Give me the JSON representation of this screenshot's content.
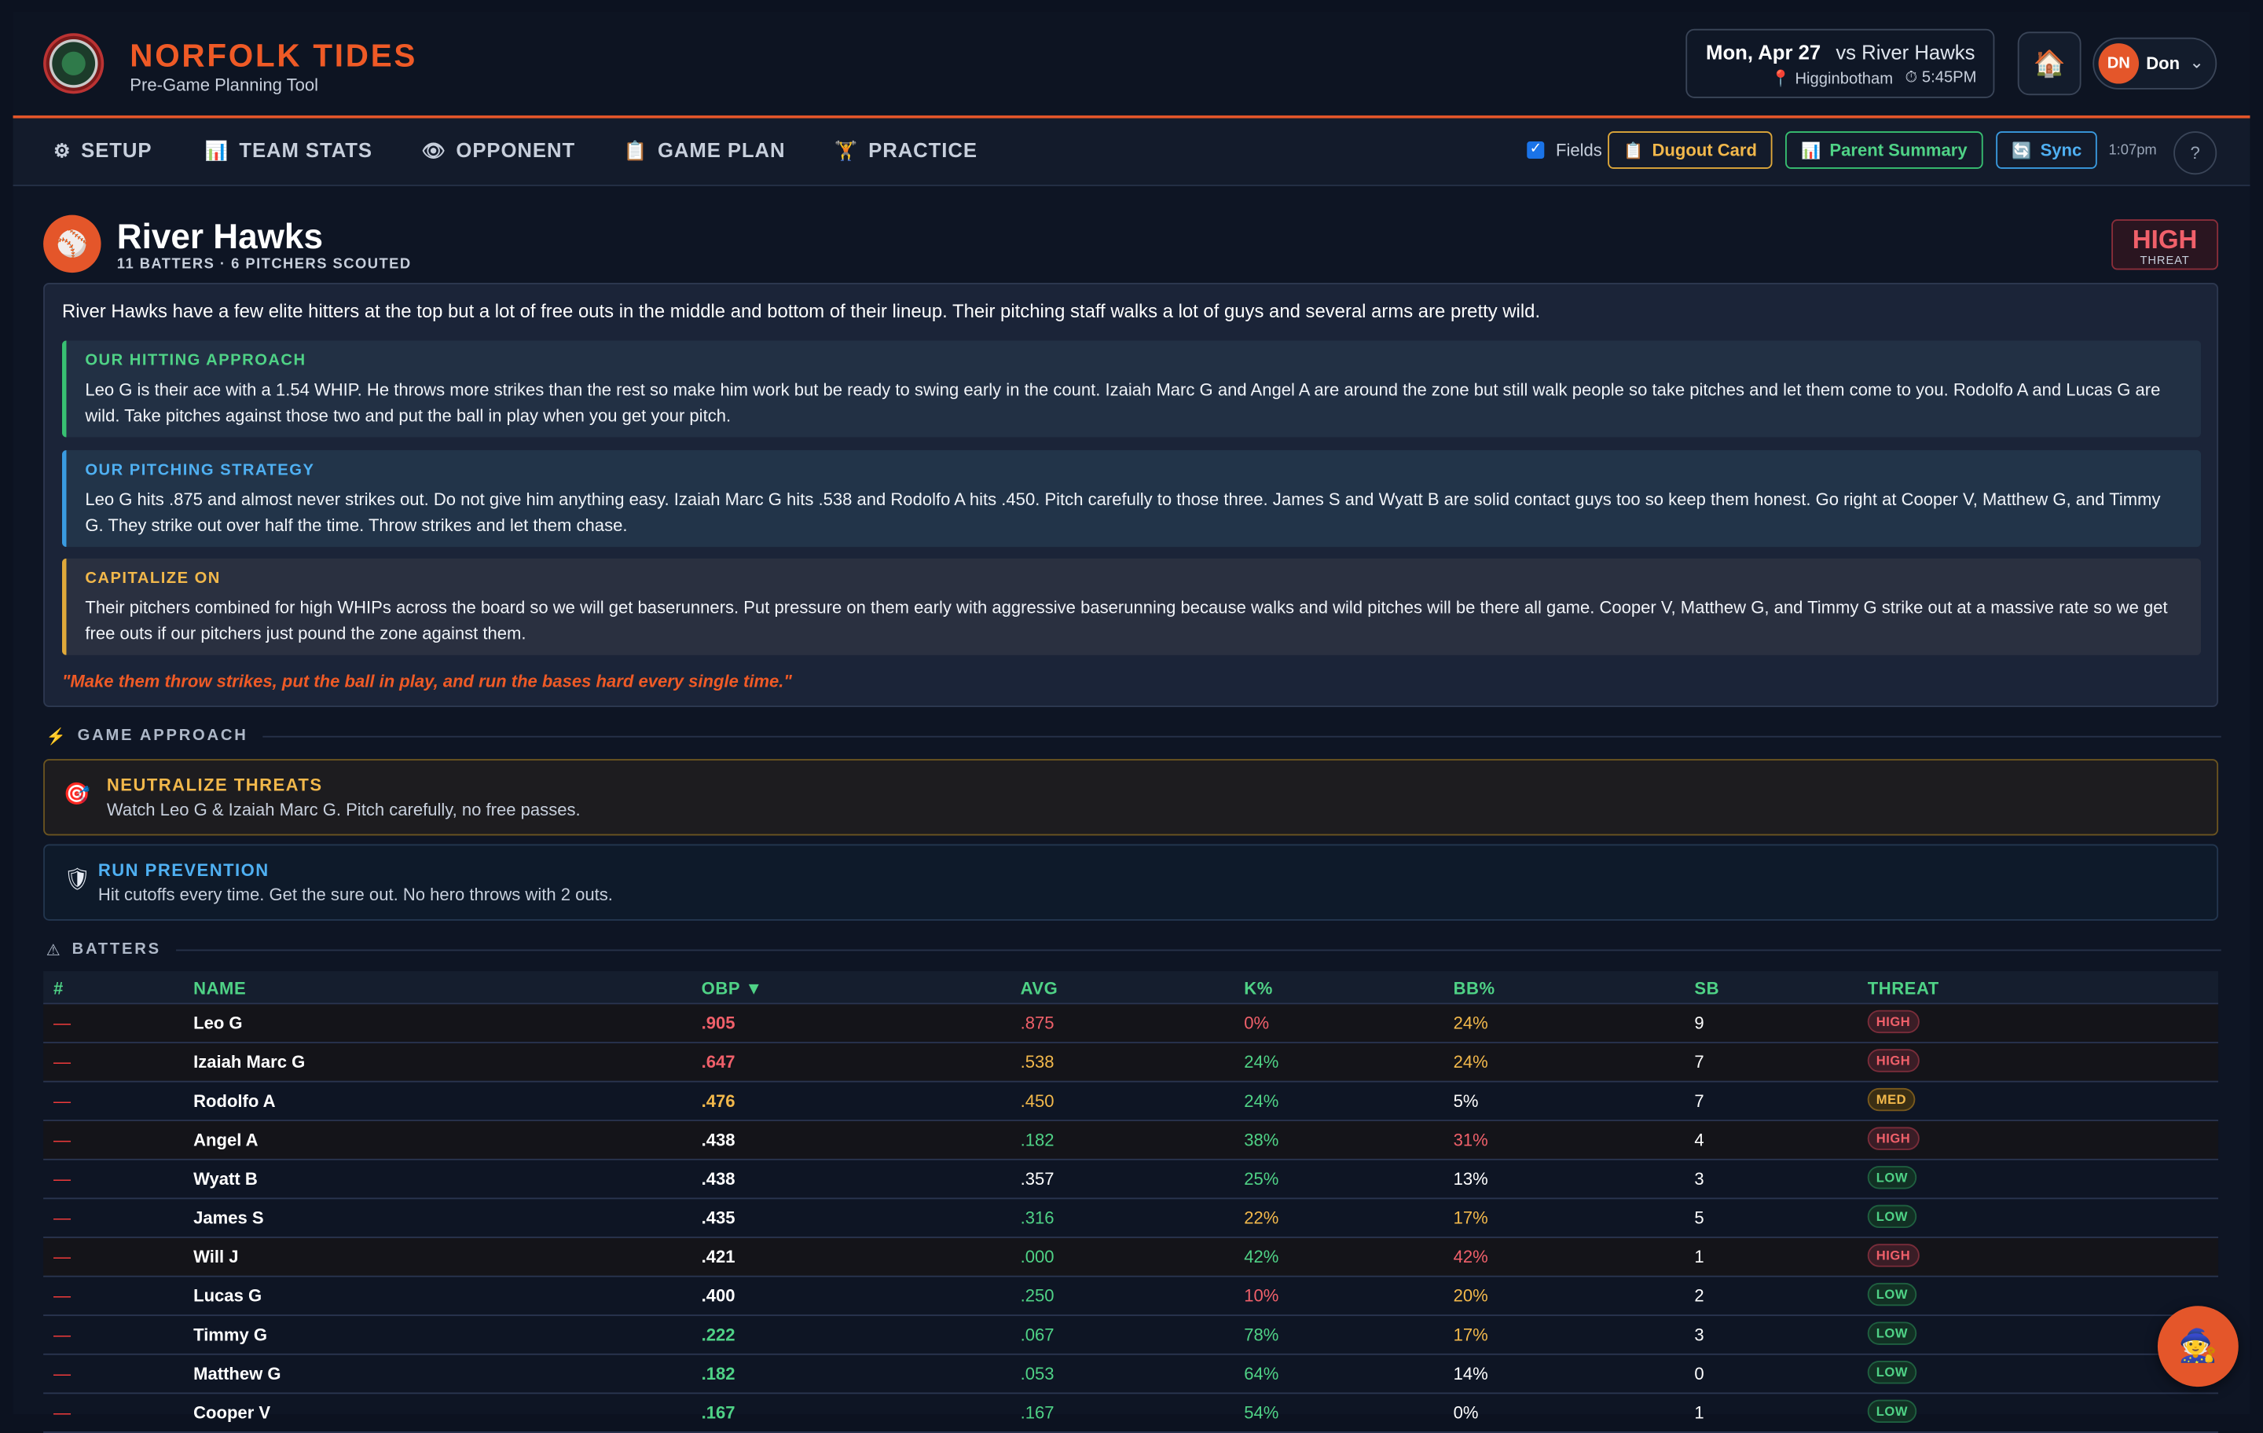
{
  "header": {
    "brand_title": "NORFOLK TIDES",
    "brand_subtitle": "Pre-Game Planning Tool",
    "game_date": "Mon, Apr 27",
    "game_opponent": "vs River Hawks",
    "game_location": "📍 Higginbotham",
    "game_time": "⏱ 5:45PM",
    "home_icon": "🏠",
    "user_initials": "DN",
    "user_name": "Don",
    "user_chevron": "⌄"
  },
  "nav": {
    "tabs": [
      {
        "label": "SETUP",
        "icon": "⚙"
      },
      {
        "label": "TEAM STATS",
        "icon": "📊"
      },
      {
        "label": "OPPONENT",
        "icon": "👁"
      },
      {
        "label": "GAME PLAN",
        "icon": "📋"
      },
      {
        "label": "PRACTICE",
        "icon": "🏋"
      }
    ],
    "fields_label": "Fields",
    "dugout_label": "Dugout Card",
    "dugout_icon": "📋",
    "parent_label": "Parent Summary",
    "parent_icon": "📊",
    "sync_label": "Sync",
    "sync_icon": "🔄",
    "clock": "1:07pm",
    "help": "?"
  },
  "opponent": {
    "icon": "⚾",
    "name": "River Hawks",
    "meta": "11 BATTERS · 6 PITCHERS SCOUTED",
    "threat_level": "HIGH",
    "threat_label": "THREAT"
  },
  "summary": {
    "text": "River Hawks have a few elite hitters at the top but a lot of free outs in the middle and bottom of their lineup. Their pitching staff walks a lot of guys and several arms are pretty wild.",
    "hitting_title": "OUR HITTING APPROACH",
    "hitting_body": "Leo G is their ace with a 1.54 WHIP. He throws more strikes than the rest so make him work but be ready to swing early in the count. Izaiah Marc G and Angel A are around the zone but still walk people so take pitches and let them come to you. Rodolfo A and Lucas G are wild. Take pitches against those two and put the ball in play when you get your pitch.",
    "pitching_title": "OUR PITCHING STRATEGY",
    "pitching_body": "Leo G hits .875 and almost never strikes out. Do not give him anything easy. Izaiah Marc G hits .538 and Rodolfo A hits .450. Pitch carefully to those three. James S and Wyatt B are solid contact guys too so keep them honest. Go right at Cooper V, Matthew G, and Timmy G. They strike out over half the time. Throw strikes and let them chase.",
    "capitalize_title": "CAPITALIZE ON",
    "capitalize_body": "Their pitchers combined for high WHIPs across the board so we will get baserunners. Put pressure on them early with aggressive baserunning because walks and wild pitches will be there all game. Cooper V, Matthew G, and Timmy G strike out at a massive rate so we get free outs if our pitchers just pound the zone against them.",
    "slogan": "\"Make them throw strikes, put the ball in play, and run the bases hard every single time.\""
  },
  "approach": {
    "section_icon": "⚡",
    "section_label": "GAME APPROACH",
    "neutralize_icon": "🎯",
    "neutralize_title": "NEUTRALIZE THREATS",
    "neutralize_body": "Watch Leo G & Izaiah Marc G. Pitch carefully, no free passes.",
    "run_icon": "🛡",
    "run_title": "RUN PREVENTION",
    "run_body": "Hit cutoffs every time. Get the sure out. No hero throws with 2 outs."
  },
  "batters": {
    "section_icon": "⚠",
    "section_label": "BATTERS",
    "headers": {
      "num": "#",
      "name": "NAME",
      "obp": "OBP ▼",
      "avg": "AVG",
      "k": "K%",
      "bb": "BB%",
      "sb": "SB",
      "threat": "THREAT"
    },
    "colors": {
      "red": "#f0606a",
      "orange": "#f2b84b",
      "green": "#4fd286",
      "white": "#ffffff"
    },
    "rows": [
      {
        "num": "—",
        "name": "Leo G",
        "obp": ".905",
        "avg": ".875",
        "k": "0%",
        "bb": "24%",
        "sb": "9",
        "threat": "HIGH",
        "obp_c": "red",
        "avg_c": "red",
        "k_c": "red",
        "bb_c": "orange"
      },
      {
        "num": "—",
        "name": "Izaiah Marc G",
        "obp": ".647",
        "avg": ".538",
        "k": "24%",
        "bb": "24%",
        "sb": "7",
        "threat": "HIGH",
        "obp_c": "red",
        "avg_c": "orange",
        "k_c": "green",
        "bb_c": "orange"
      },
      {
        "num": "—",
        "name": "Rodolfo A",
        "obp": ".476",
        "avg": ".450",
        "k": "24%",
        "bb": "5%",
        "sb": "7",
        "threat": "MED",
        "obp_c": "orange",
        "avg_c": "orange",
        "k_c": "green",
        "bb_c": "white"
      },
      {
        "num": "—",
        "name": "Angel A",
        "obp": ".438",
        "avg": ".182",
        "k": "38%",
        "bb": "31%",
        "sb": "4",
        "threat": "HIGH",
        "obp_c": "white",
        "avg_c": "green",
        "k_c": "green",
        "bb_c": "red"
      },
      {
        "num": "—",
        "name": "Wyatt B",
        "obp": ".438",
        "avg": ".357",
        "k": "25%",
        "bb": "13%",
        "sb": "3",
        "threat": "LOW",
        "obp_c": "white",
        "avg_c": "white",
        "k_c": "green",
        "bb_c": "white"
      },
      {
        "num": "—",
        "name": "James S",
        "obp": ".435",
        "avg": ".316",
        "k": "22%",
        "bb": "17%",
        "sb": "5",
        "threat": "LOW",
        "obp_c": "white",
        "avg_c": "green",
        "k_c": "orange",
        "bb_c": "orange"
      },
      {
        "num": "—",
        "name": "Will J",
        "obp": ".421",
        "avg": ".000",
        "k": "42%",
        "bb": "42%",
        "sb": "1",
        "threat": "HIGH",
        "obp_c": "white",
        "avg_c": "green",
        "k_c": "green",
        "bb_c": "red"
      },
      {
        "num": "—",
        "name": "Lucas G",
        "obp": ".400",
        "avg": ".250",
        "k": "10%",
        "bb": "20%",
        "sb": "2",
        "threat": "LOW",
        "obp_c": "white",
        "avg_c": "green",
        "k_c": "red",
        "bb_c": "orange"
      },
      {
        "num": "—",
        "name": "Timmy G",
        "obp": ".222",
        "avg": ".067",
        "k": "78%",
        "bb": "17%",
        "sb": "3",
        "threat": "LOW",
        "obp_c": "green",
        "avg_c": "green",
        "k_c": "green",
        "bb_c": "orange"
      },
      {
        "num": "—",
        "name": "Matthew G",
        "obp": ".182",
        "avg": ".053",
        "k": "64%",
        "bb": "14%",
        "sb": "0",
        "threat": "LOW",
        "obp_c": "green",
        "avg_c": "green",
        "k_c": "green",
        "bb_c": "white"
      },
      {
        "num": "—",
        "name": "Cooper V",
        "obp": ".167",
        "avg": ".167",
        "k": "54%",
        "bb": "0%",
        "sb": "1",
        "threat": "LOW",
        "obp_c": "green",
        "avg_c": "green",
        "k_c": "green",
        "bb_c": "white"
      }
    ]
  },
  "fab": {
    "icon": "🧙"
  }
}
